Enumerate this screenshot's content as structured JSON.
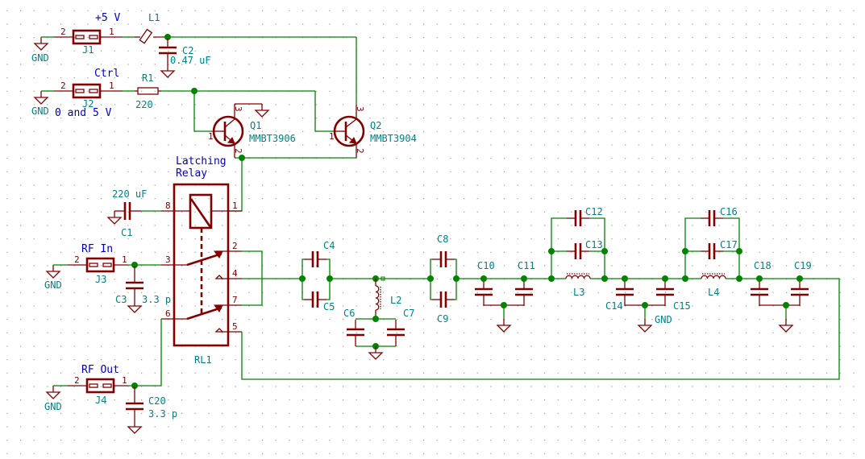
{
  "colors": {
    "wire": "#008400",
    "component": "#840000",
    "reference_text": "#008484",
    "net_label_text": "#0000c4",
    "grid": "#9a9a9a",
    "background": "#ffffff"
  },
  "gnd_label": "GND",
  "net_labels": {
    "plus5v": "+5 V",
    "ctrl": "Ctrl",
    "ctrl_range": "0 and 5 V",
    "relay_line1": "Latching",
    "relay_line2": "Relay",
    "rf_in": "RF In",
    "rf_out": "RF Out"
  },
  "pin_numbers": {
    "1": "1",
    "2": "2",
    "3": "3",
    "4": "4",
    "5": "5",
    "6": "6",
    "7": "7",
    "8": "8"
  },
  "components": {
    "J1": {
      "ref": "J1"
    },
    "J2": {
      "ref": "J2"
    },
    "J3": {
      "ref": "J3"
    },
    "J4": {
      "ref": "J4"
    },
    "L1": {
      "ref": "L1"
    },
    "C2": {
      "ref": "C2",
      "value": "0.47 uF"
    },
    "R1": {
      "ref": "R1",
      "value": "220"
    },
    "Q1": {
      "ref": "Q1",
      "value": "MMBT3906"
    },
    "Q2": {
      "ref": "Q2",
      "value": "MMBT3904"
    },
    "C1": {
      "ref": "C1",
      "value": "220 uF"
    },
    "RL1": {
      "ref": "RL1"
    },
    "C3": {
      "ref": "C3",
      "value": "3.3 p"
    },
    "C20": {
      "ref": "C20",
      "value": "3.3 p"
    },
    "C4": {
      "ref": "C4"
    },
    "C5": {
      "ref": "C5"
    },
    "C6": {
      "ref": "C6"
    },
    "C7": {
      "ref": "C7"
    },
    "L2": {
      "ref": "L2"
    },
    "C8": {
      "ref": "C8"
    },
    "C9": {
      "ref": "C9"
    },
    "C10": {
      "ref": "C10"
    },
    "C11": {
      "ref": "C11"
    },
    "C12": {
      "ref": "C12"
    },
    "C13": {
      "ref": "C13"
    },
    "L3": {
      "ref": "L3"
    },
    "C14": {
      "ref": "C14"
    },
    "C15": {
      "ref": "C15"
    },
    "C16": {
      "ref": "C16"
    },
    "C17": {
      "ref": "C17"
    },
    "L4": {
      "ref": "L4"
    },
    "C18": {
      "ref": "C18"
    },
    "C19": {
      "ref": "C19"
    }
  }
}
